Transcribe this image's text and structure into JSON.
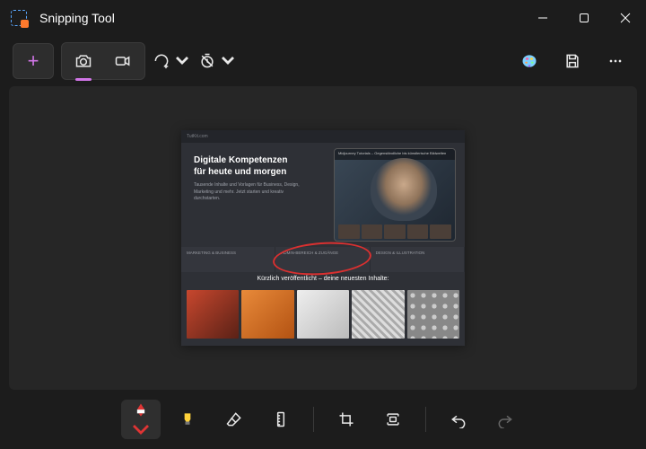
{
  "window": {
    "title": "Snipping Tool"
  },
  "top_toolbar": {
    "new_label": "New",
    "camera_label": "Snapshot",
    "video_label": "Record",
    "shape_label": "Snip shape",
    "delay_label": "Delay"
  },
  "bottom_toolbar": {
    "pen": "Ballpoint pen",
    "highlighter": "Highlighter",
    "eraser": "Eraser",
    "ruler": "Ruler",
    "crop": "Crop",
    "text_actions": "Text actions",
    "undo": "Undo",
    "redo": "Redo"
  },
  "colors": {
    "accent": "#d276e8",
    "pen": "#e03434",
    "highlighter": "#ffd23a"
  },
  "screenshot_content": {
    "site_brand": "TutKit.com",
    "headline_line1": "Digitale Kompetenzen",
    "headline_line2": "für heute und morgen",
    "subtext": "Tausende Inhalte und Vorlagen für Business, Design, Marketing und mehr. Jetzt starten und kreativ durchstarten.",
    "thumb_caption": "Midjourney Tutorials – Gegenständliche bis künstlerische Bildwelten",
    "band_items": [
      "MARKETING & BUSINESS",
      "ADMIN-BEREICH & ZUGÄNGE",
      "DESIGN & ILLUSTRATION"
    ],
    "section_title": "Kürzlich veröffentlicht – deine neuesten Inhalte:"
  }
}
